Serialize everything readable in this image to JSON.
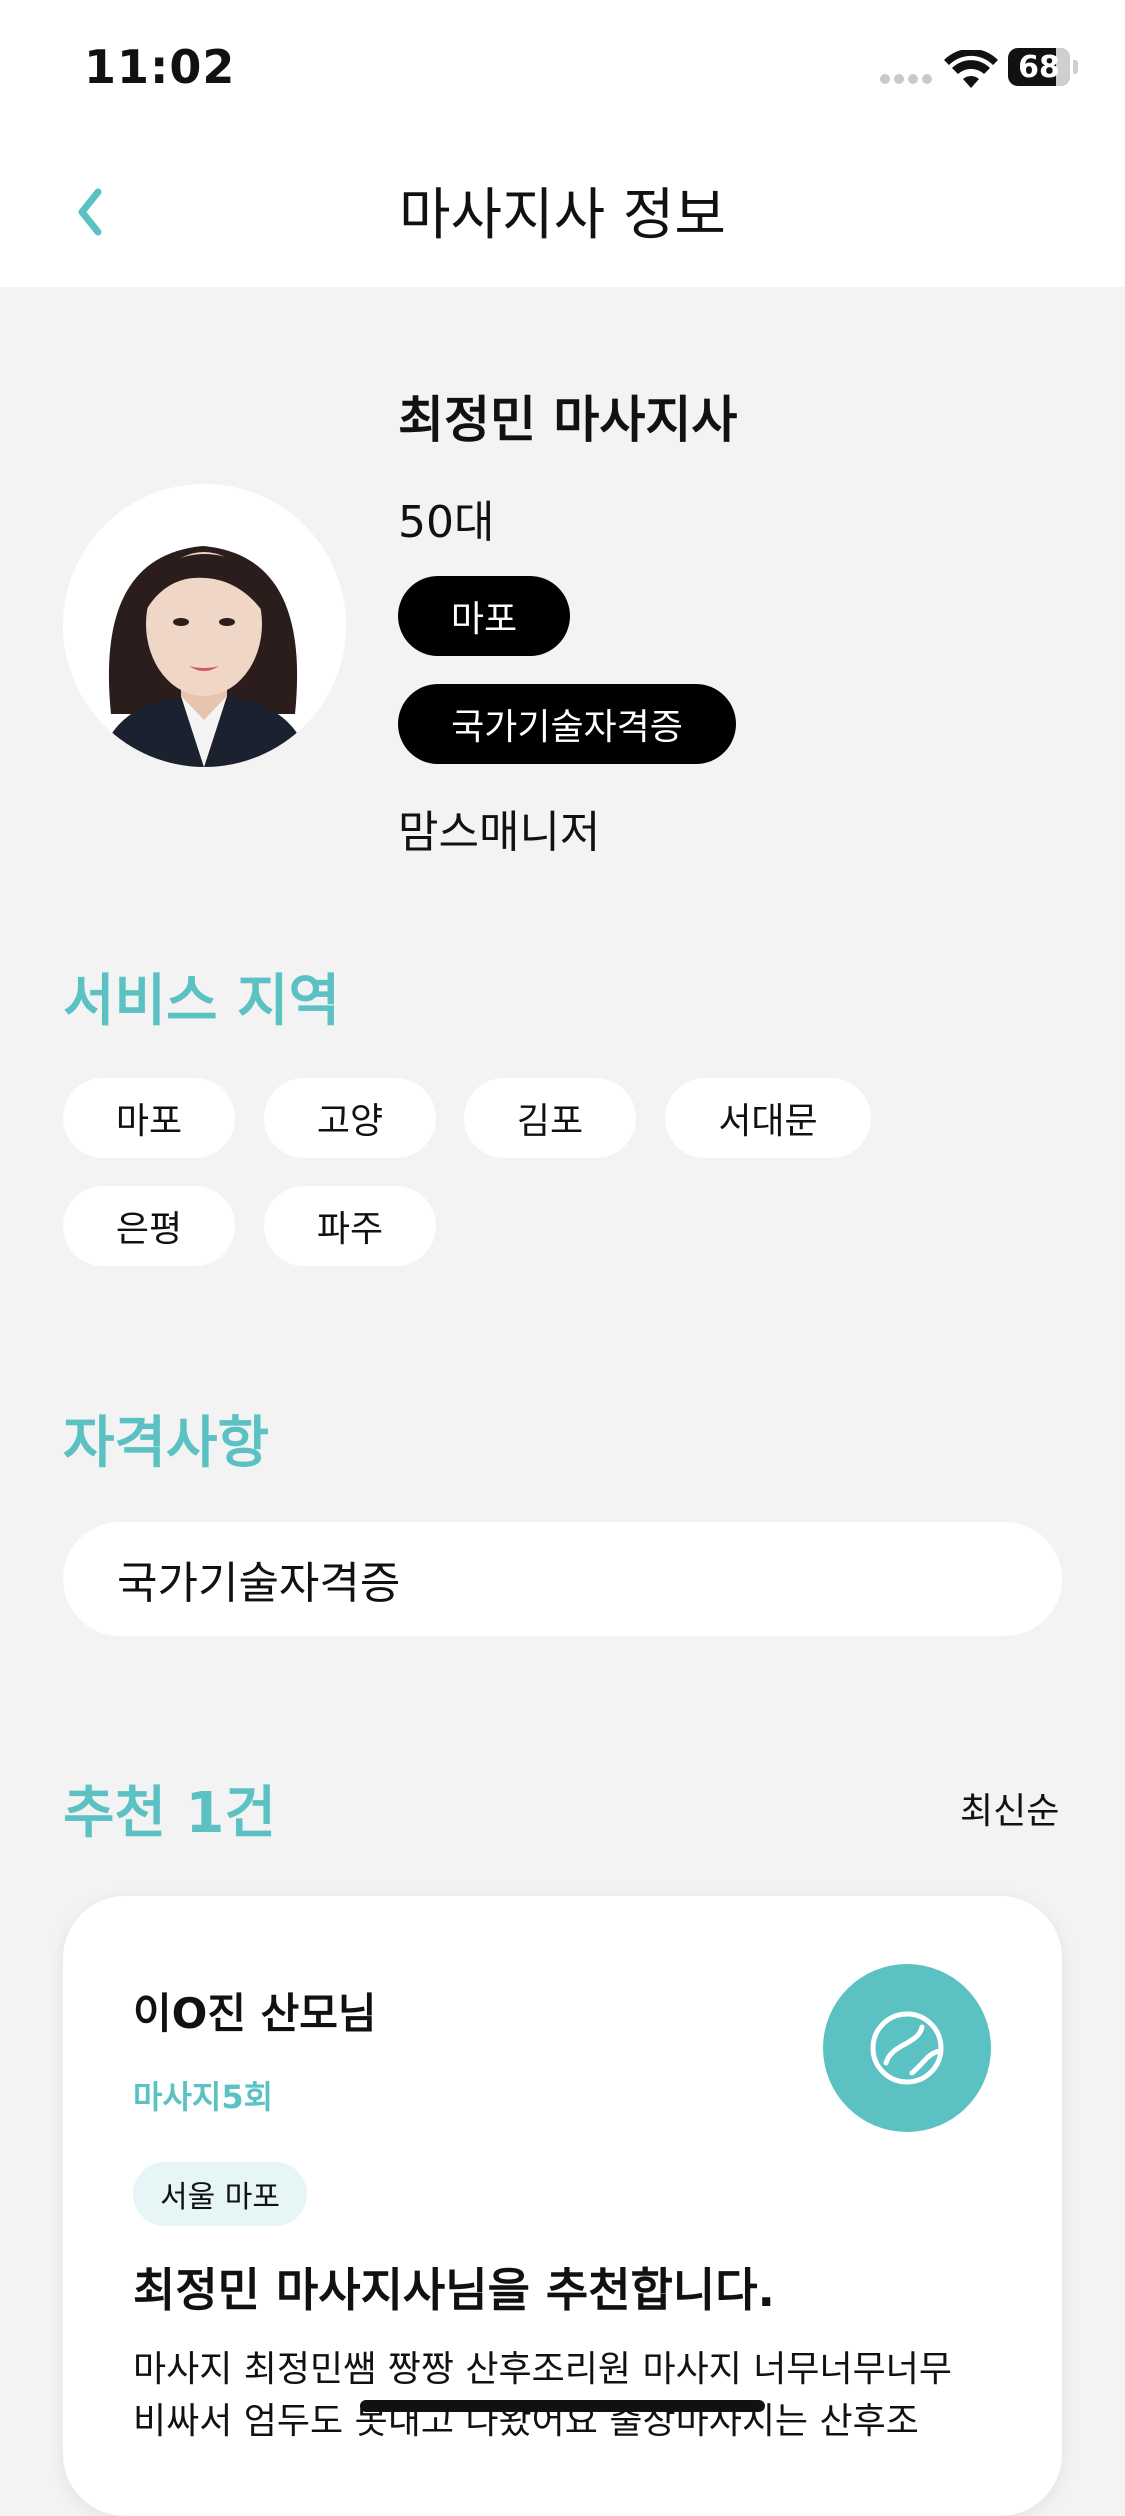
{
  "status_bar": {
    "time": "11:02",
    "battery": "68"
  },
  "header": {
    "title": "마사지사 정보",
    "back_icon": "chevron-left-icon",
    "accent_color": "#5cc1c3"
  },
  "profile": {
    "name": "최정민 마사지사",
    "age": "50대",
    "region_tag": "마포",
    "cert_tag": "국가기술자격증",
    "company": "맘스매니저"
  },
  "service_area": {
    "title": "서비스 지역",
    "chips": [
      "마포",
      "고양",
      "김포",
      "서대문",
      "은평",
      "파주"
    ]
  },
  "qualifications": {
    "title": "자격사항",
    "items": [
      "국가기술자격증"
    ]
  },
  "recommendations": {
    "title": "추천 1건",
    "sort_label": "최신순",
    "reviews": [
      {
        "reviewer": "이O진 산모님",
        "massage_count": "마사지5회",
        "region": "서울 마포",
        "title": "최정민 마사지사님을 추천합니다.",
        "body": "마사지 최정민쌤 짱짱 산후조리원 마사지 너무너무너무 비싸서 엄두도 못내고 나왔어요 출장마사지는 산후조"
      }
    ]
  }
}
